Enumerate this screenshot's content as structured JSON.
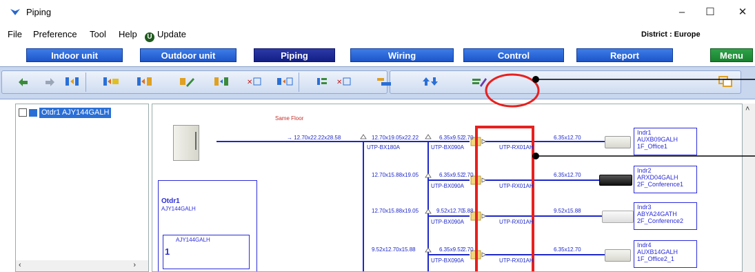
{
  "window": {
    "title": "Piping",
    "minimize": "–",
    "maximize": "☐",
    "close": "✕"
  },
  "menu": {
    "items": [
      "File",
      "Preference",
      "Tool",
      "Help",
      "Update"
    ],
    "district": "District : Europe"
  },
  "tabs": [
    "Indoor unit",
    "Outdoor unit",
    "Piping",
    "Wiring",
    "Control",
    "Report",
    "Menu"
  ],
  "active_tab": "Piping",
  "toolbar": {
    "icons": [
      "undo-icon",
      "redo-icon",
      "swap-icon",
      "add-branch-icon",
      "insert-branch-icon",
      "edit-pipe-icon",
      "connect-icon",
      "delete-branch-icon",
      "move-branch-icon",
      "align-icon",
      "delete-icon",
      "header-icon",
      "up-down-icon",
      "edit-icon",
      "copy-icon"
    ]
  },
  "tree": {
    "root_label": "Otdr1 AJY144GALH"
  },
  "diagram": {
    "floor_label": "Same Floor",
    "main_pipe": "12.70x22.22x28.58",
    "outdoor": {
      "name": "Otdr1",
      "model": "AJY144GALH",
      "system_model": "AJY144GALH",
      "system_number": "1"
    },
    "branch_main": {
      "size": "12.70x19.05x22.22",
      "joint": "UTP-BX180A"
    },
    "branches": [
      {
        "pipe": "6.35x9.52",
        "len": "2.70",
        "joint": "UTP-BX090A",
        "unit_pipe": "UTP-RX01AH",
        "indoor_pipe": "6.35x12.70"
      },
      {
        "main": "12.70x15.88x19.05",
        "pipe": "6.35x9.52",
        "len": "2.70",
        "joint": "UTP-BX090A",
        "unit_pipe": "UTP-RX01AH",
        "indoor_pipe": "6.35x12.70"
      },
      {
        "main": "12.70x15.88x19.05",
        "pipe": "9.52x12.70",
        "len": "5.88",
        "joint": "UTP-BX090A",
        "unit_pipe": "UTP-RX01AH",
        "indoor_pipe": "9.52x15.88"
      },
      {
        "main": "9.52x12.70x15.88",
        "pipe": "6.35x9.52",
        "len": "2.70",
        "joint": "UTP-BX090A",
        "unit_pipe": "UTP-RX01AH",
        "indoor_pipe": "6.35x12.70"
      }
    ],
    "indoors": [
      {
        "name": "Indr1",
        "model": "AUXB09GALH",
        "location": "1F_Office1"
      },
      {
        "name": "Indr2",
        "model": "ARXD04GALH",
        "location": "2F_Conference1"
      },
      {
        "name": "Indr3",
        "model": "ABYA24GATH",
        "location": "2F_Conference2"
      },
      {
        "name": "Indr4",
        "model": "AUXB14GALH",
        "location": "1F_Office2_1"
      }
    ]
  },
  "colors": {
    "pipe": "#1d27c8",
    "highlight": "#e8201e",
    "tab": "#1c55c8",
    "menu_tab": "#17822e"
  }
}
